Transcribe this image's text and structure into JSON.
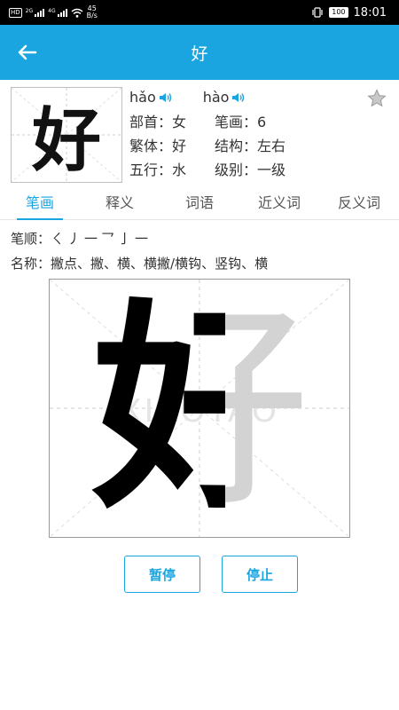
{
  "status_bar": {
    "hd_badge": "HD",
    "net_2g": "2G",
    "net_4g": "4G",
    "speed_value": "45",
    "speed_unit": "B/s",
    "battery": "100",
    "time": "18:01"
  },
  "app_bar": {
    "back_icon": "arrow-left-icon",
    "title": "好"
  },
  "character": {
    "glyph": "好",
    "pinyin": [
      {
        "text": "hǎo",
        "icon": "speaker-icon"
      },
      {
        "text": "hào",
        "icon": "speaker-icon"
      }
    ],
    "favorite_icon": "star-icon",
    "info": [
      {
        "label": "部首：女",
        "label2": "笔画：6"
      },
      {
        "label": "繁体：好",
        "label2": "结构：左右"
      },
      {
        "label": "五行：水",
        "label2": "级别：一级"
      }
    ]
  },
  "tabs": [
    {
      "label": "笔画",
      "active": true
    },
    {
      "label": "释义",
      "active": false
    },
    {
      "label": "词语",
      "active": false
    },
    {
      "label": "近义词",
      "active": false
    },
    {
      "label": "反义词",
      "active": false
    }
  ],
  "strokes": {
    "order_label": "笔顺：",
    "order_value": "ㄑ丿一乛亅一",
    "name_label": "名称：",
    "name_value": "撇点、撇、横、横撇/横钩、竖钩、横"
  },
  "writing_grid": {
    "ghost_char": "好",
    "ink_char": "好",
    "watermark": "XIAOTAO"
  },
  "buttons": {
    "pause": "暂停",
    "stop": "停止"
  },
  "colors": {
    "accent": "#1aa5e0",
    "status_bar": "#000000"
  }
}
